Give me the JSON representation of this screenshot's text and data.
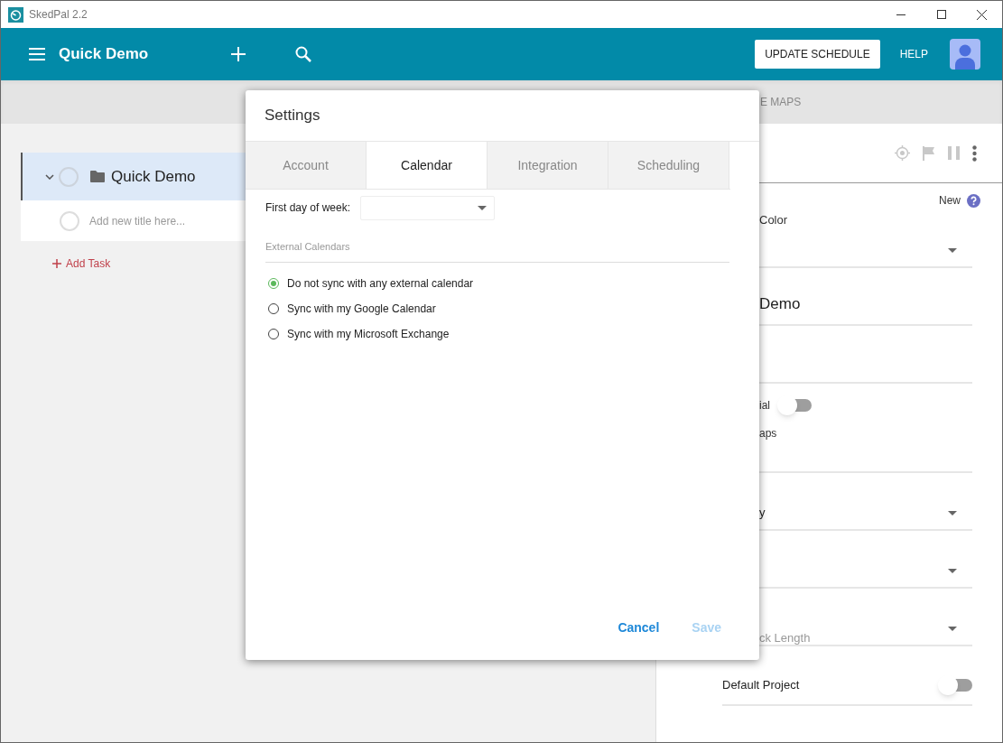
{
  "window": {
    "title": "SkedPal 2.2"
  },
  "app_bar": {
    "title": "Quick Demo",
    "update_button": "UPDATE SCHEDULE",
    "help": "HELP"
  },
  "view_tabs": [
    {
      "label": "E MAPS",
      "selected": false
    }
  ],
  "tree": {
    "items": [
      {
        "title": "Quick Demo",
        "expanded": true,
        "selected": true
      }
    ],
    "new_item_placeholder": "Add new title here...",
    "add_task": "Add Task"
  },
  "detail": {
    "new_label": "New",
    "fields": [
      {
        "kind": "select",
        "label": "Color"
      },
      {
        "kind": "text",
        "value": "Demo"
      },
      {
        "kind": "text"
      },
      {
        "kind": "toggle",
        "label": "ial",
        "on": false,
        "sub_label": "aps"
      },
      {
        "kind": "select",
        "value": "y"
      },
      {
        "kind": "select"
      },
      {
        "kind": "select",
        "placeholder": "ck Length"
      },
      {
        "kind": "switch",
        "label": "Default Project",
        "on": false
      }
    ]
  },
  "dialog": {
    "title": "Settings",
    "tabs": [
      {
        "label": "Account",
        "selected": false
      },
      {
        "label": "Calendar",
        "selected": true
      },
      {
        "label": "Integration",
        "selected": false
      },
      {
        "label": "Scheduling",
        "selected": false
      }
    ],
    "first_day_label": "First day of week:",
    "section": "External Calendars",
    "options": [
      {
        "label": "Do not sync with any external calendar",
        "selected": true
      },
      {
        "label": "Sync with my Google Calendar",
        "selected": false
      },
      {
        "label": "Sync with my Microsoft Exchange",
        "selected": false
      }
    ],
    "buttons": [
      {
        "label": "Cancel",
        "disabled": false
      },
      {
        "label": "Save",
        "disabled": true
      }
    ]
  }
}
